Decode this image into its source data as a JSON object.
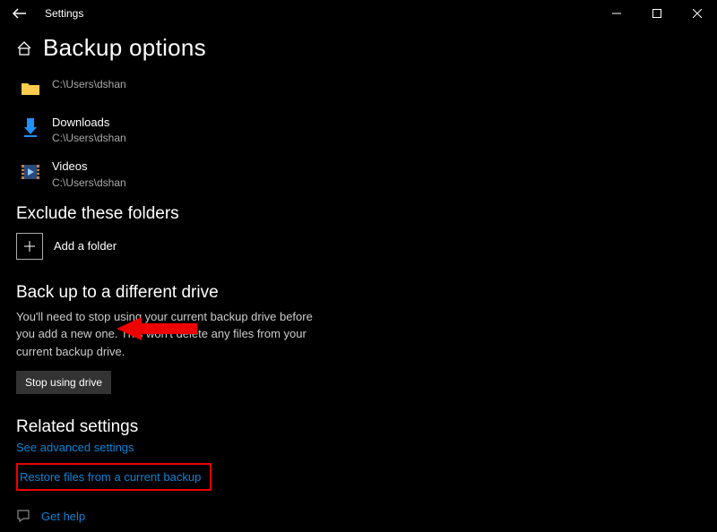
{
  "titlebar": {
    "title": "Settings"
  },
  "page_title": "Backup options",
  "folders": [
    {
      "name": "",
      "path": "C:\\Users\\dshan",
      "icon": "folder"
    },
    {
      "name": "Downloads",
      "path": "C:\\Users\\dshan",
      "icon": "downloads"
    },
    {
      "name": "Videos",
      "path": "C:\\Users\\dshan",
      "icon": "videos"
    }
  ],
  "exclude": {
    "heading": "Exclude these folders",
    "add_label": "Add a folder"
  },
  "different_drive": {
    "heading": "Back up to a different drive",
    "body": "You'll need to stop using your current backup drive before you add a new one. This won't delete any files from your current backup drive.",
    "button": "Stop using drive"
  },
  "related": {
    "heading": "Related settings",
    "advanced_link": "See advanced settings",
    "restore_link": "Restore files from a current backup"
  },
  "help": {
    "label": "Get help"
  }
}
